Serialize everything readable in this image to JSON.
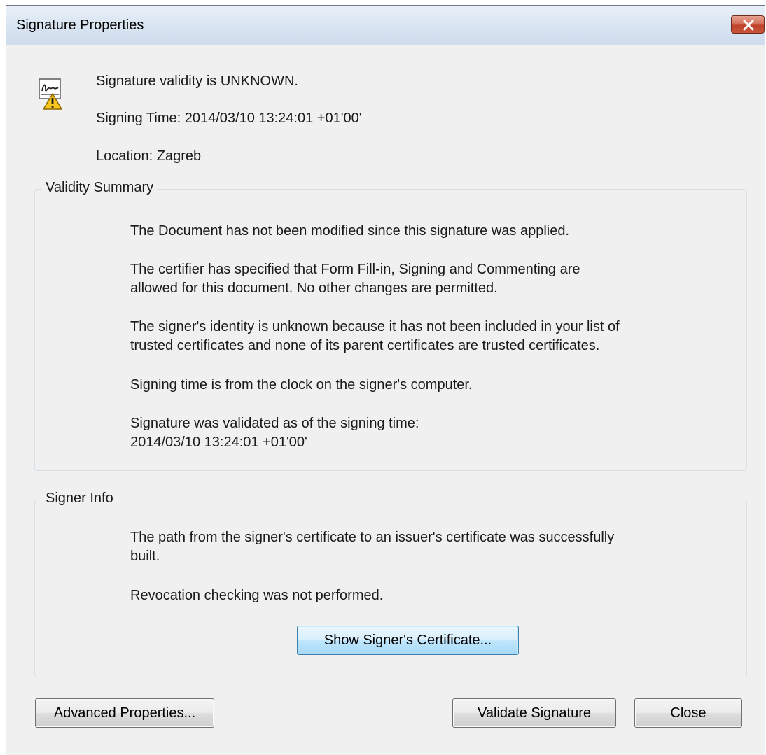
{
  "window": {
    "title": "Signature Properties"
  },
  "header": {
    "validity": "Signature validity is UNKNOWN.",
    "signing_time": "Signing Time:  2014/03/10 13:24:01 +01'00'",
    "location": "Location:  Zagreb"
  },
  "validity_summary": {
    "label": "Validity Summary",
    "p1": "The Document has not been modified since this signature was applied.",
    "p2_l1": "The certifier has specified that Form Fill-in, Signing and Commenting are",
    "p2_l2": "allowed for this document. No other changes are permitted.",
    "p3_l1": "The signer's identity is unknown because it has not been included in your list of",
    "p3_l2": "trusted certificates and none of its parent certificates are trusted certificates.",
    "p4": "Signing time is from the clock on the signer's computer.",
    "p5_l1": "Signature was validated as of the signing time:",
    "p5_l2": "2014/03/10 13:24:01 +01'00'"
  },
  "signer_info": {
    "label": "Signer Info",
    "p1_l1": "The path from the signer's certificate to an issuer's certificate was successfully",
    "p1_l2": "built.",
    "p2": "Revocation checking was not performed.",
    "show_cert_button": "Show Signer's Certificate..."
  },
  "footer": {
    "advanced_button": "Advanced Properties...",
    "validate_button": "Validate Signature",
    "close_button": "Close"
  },
  "icons": {
    "signature_warning": "signature-warning-icon",
    "close": "close-icon"
  },
  "colors": {
    "close_button_red": "#c8553c",
    "focused_button_blue": "#3c7fb1",
    "dialog_background": "#f0f0f0"
  }
}
